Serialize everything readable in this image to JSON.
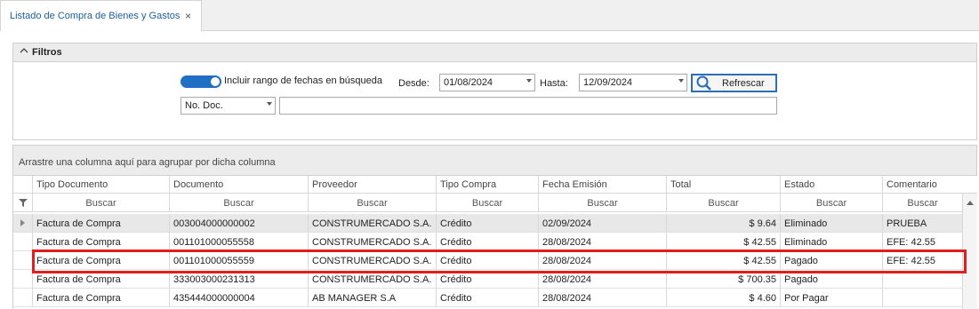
{
  "tab": {
    "title": "Listado de Compra de Bienes y Gastos",
    "close": "×"
  },
  "filters": {
    "title": "Filtros",
    "toggle_label": "Incluir rango de fechas en búsqueda",
    "desde_label": "Desde:",
    "desde_value": "01/08/2024",
    "hasta_label": "Hasta:",
    "hasta_value": "12/09/2024",
    "refresh_label": "Refrescar",
    "field_select": "No. Doc.",
    "search_value": ""
  },
  "grid": {
    "group_hint": "Arrastre una columna aquí para agrupar por dicha columna",
    "columns": [
      "Tipo Documento",
      "Documento",
      "Proveedor",
      "Tipo Compra",
      "Fecha Emisión",
      "Total",
      "Estado",
      "Comentario"
    ],
    "filter_placeholder": "Buscar",
    "rows": [
      [
        "Factura de Compra",
        "003004000000002",
        "CONSTRUMERCADO S.A.",
        "Crédito",
        "02/09/2024",
        "$ 9.64",
        "Eliminado",
        "PRUEBA"
      ],
      [
        "Factura de Compra",
        "001101000055558",
        "CONSTRUMERCADO S.A.",
        "Crédito",
        "28/08/2024",
        "$ 42.55",
        "Eliminado",
        "EFE: 42.55"
      ],
      [
        "Factura de Compra",
        "001101000055559",
        "CONSTRUMERCADO S.A.",
        "Crédito",
        "28/08/2024",
        "$ 42.55",
        "Pagado",
        "EFE: 42.55"
      ],
      [
        "Factura de Compra",
        "333003000231313",
        "CONSTRUMERCADO S.A.",
        "Crédito",
        "28/08/2024",
        "$ 700.35",
        "Pagado",
        ""
      ],
      [
        "Factura de Compra",
        "435444000000004",
        "AB MANAGER S.A",
        "Crédito",
        "28/08/2024",
        "$ 4.60",
        "Por Pagar",
        ""
      ]
    ]
  },
  "colors": {
    "accent": "#1f6fc5",
    "highlight": "#e01e1e"
  },
  "icons": [
    "close-icon",
    "chevron-up-icon",
    "search-icon",
    "filter-icon",
    "row-indicator-icon",
    "scroll-up-icon"
  ]
}
